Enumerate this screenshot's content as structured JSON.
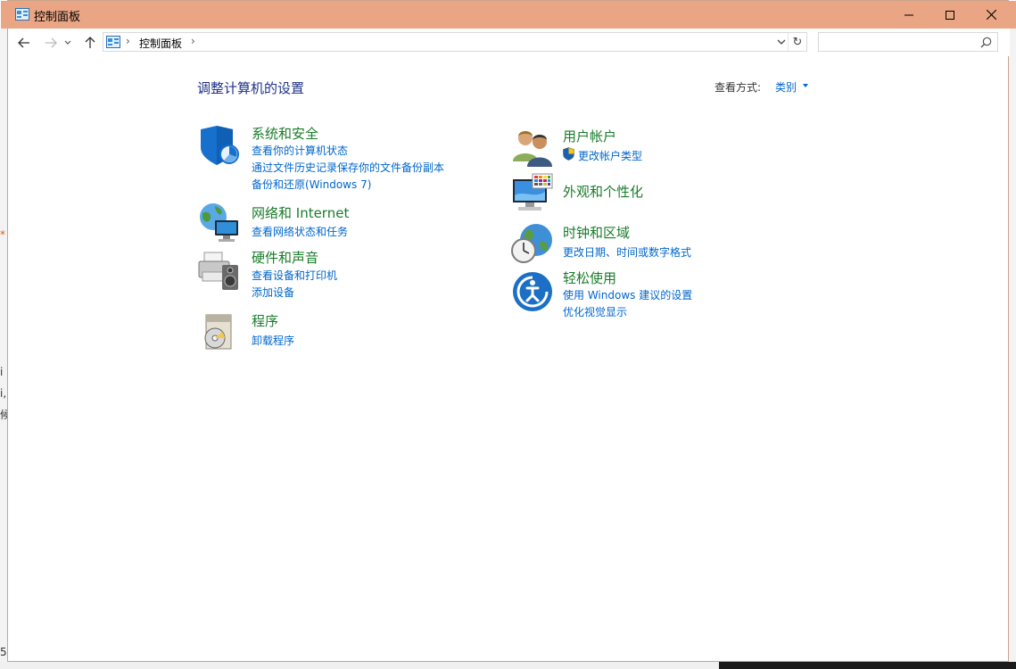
{
  "window": {
    "title": "控制面板",
    "controls": {
      "minimize": "minimize",
      "maximize": "maximize",
      "close": "close"
    }
  },
  "address": {
    "crumb": "控制面板",
    "search_placeholder": ""
  },
  "main": {
    "heading": "调整计算机的设置",
    "view_by_label": "查看方式:",
    "view_by_value": "类别"
  },
  "categories": [
    {
      "title": "系统和安全",
      "icon": "shield-icon",
      "links": [
        "查看你的计算机状态",
        "通过文件历史记录保存你的文件备份副本",
        "备份和还原(Windows 7)"
      ]
    },
    {
      "title": "网络和 Internet",
      "icon": "network-globe-icon",
      "links": [
        "查看网络状态和任务"
      ]
    },
    {
      "title": "硬件和声音",
      "icon": "printer-speaker-icon",
      "links": [
        "查看设备和打印机",
        "添加设备"
      ]
    },
    {
      "title": "程序",
      "icon": "programs-disc-icon",
      "links": [
        "卸载程序"
      ]
    },
    {
      "title": "用户帐户",
      "icon": "users-icon",
      "links": [
        "更改帐户类型"
      ]
    },
    {
      "title": "外观和个性化",
      "icon": "monitor-palette-icon",
      "links": []
    },
    {
      "title": "时钟和区域",
      "icon": "clock-globe-icon",
      "links": [
        "更改日期、时间或数字格式"
      ]
    },
    {
      "title": "轻松使用",
      "icon": "ease-of-access-icon",
      "links": [
        "使用 Windows 建议的设置",
        "优化视觉显示"
      ]
    }
  ],
  "colors": {
    "titlebar": "#e9a584",
    "heading": "#1e3287",
    "category_title": "#1a7b2a",
    "link": "#0066cc"
  },
  "background_fragments": [
    "*",
    "i",
    "i,",
    "候",
    "5"
  ]
}
